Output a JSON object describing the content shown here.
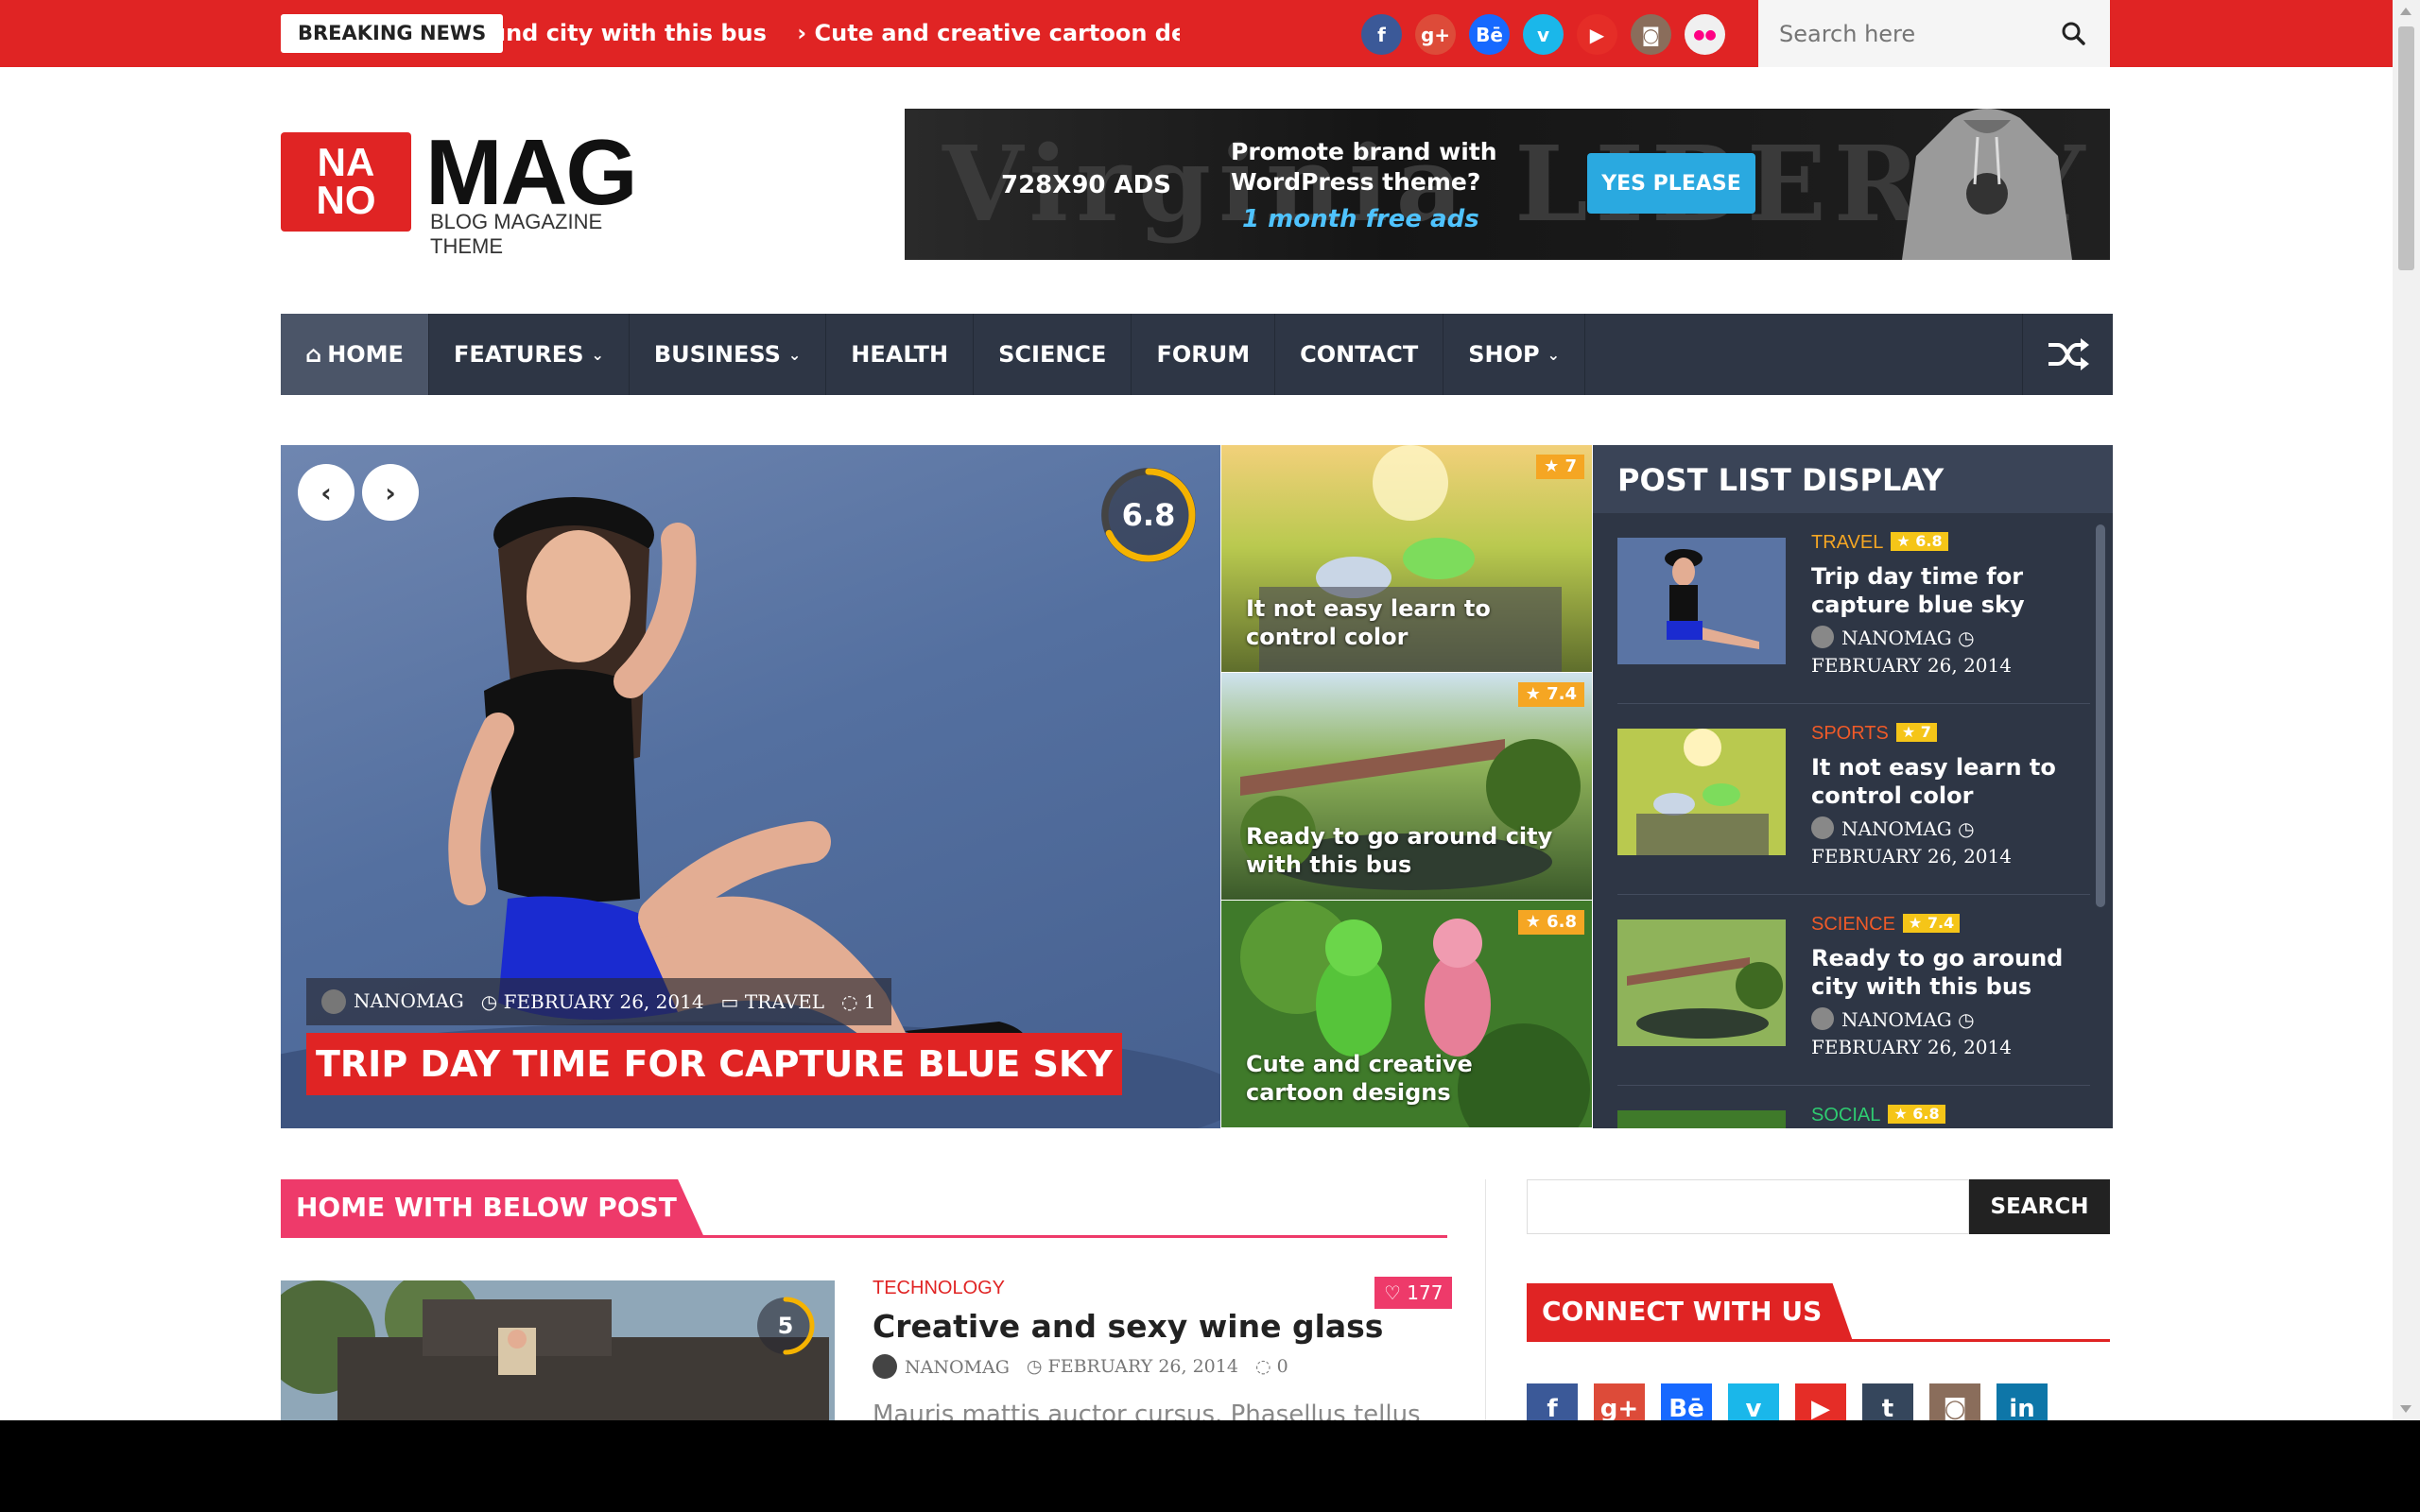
{
  "topbar": {
    "breaking_label": "BREAKING NEWS",
    "ticker": [
      "und city with this bus",
      "› Cute and creative cartoon designs",
      "›"
    ],
    "social": [
      {
        "icon": "facebook-icon",
        "glyph": "f",
        "color": "#3b5998"
      },
      {
        "icon": "google-plus-icon",
        "glyph": "g+",
        "color": "#dd4b39"
      },
      {
        "icon": "behance-icon",
        "glyph": "Bē",
        "color": "#1769ff"
      },
      {
        "icon": "vimeo-icon",
        "glyph": "v",
        "color": "#1ab7ea"
      },
      {
        "icon": "youtube-icon",
        "glyph": "▶",
        "color": "#e52d27"
      },
      {
        "icon": "instagram-icon",
        "glyph": "◙",
        "color": "#8a6d5b"
      },
      {
        "icon": "flickr-icon",
        "glyph": "●●",
        "color": "#f0f0f0"
      }
    ],
    "search_placeholder": "Search here"
  },
  "logo": {
    "box_line1": "NA",
    "box_line2": "NO",
    "word": "MAG",
    "tagline": "BLOG MAGAZINE THEME"
  },
  "ad": {
    "bg_text": "Virginia LIBERTY OR",
    "size_label": "728X90 ADS",
    "promo_line1": "Promote brand with",
    "promo_line2": "WordPress theme?",
    "free": "1 month free ads",
    "button": "YES PLEASE"
  },
  "nav": {
    "items": [
      {
        "label": "HOME",
        "icon": "home-icon",
        "active": true,
        "dropdown": false
      },
      {
        "label": "FEATURES",
        "dropdown": true
      },
      {
        "label": "BUSINESS",
        "dropdown": true
      },
      {
        "label": "HEALTH",
        "dropdown": false
      },
      {
        "label": "SCIENCE",
        "dropdown": false
      },
      {
        "label": "FORUM",
        "dropdown": false
      },
      {
        "label": "CONTACT",
        "dropdown": false
      },
      {
        "label": "SHOP",
        "dropdown": true
      }
    ]
  },
  "hero": {
    "score": "6.8",
    "score_fraction": 0.68,
    "author": "NANOMAG",
    "date": "FEBRUARY 26, 2014",
    "category": "TRAVEL",
    "comments": "1",
    "title": "TRIP DAY TIME FOR CAPTURE BLUE SKY"
  },
  "tiles": [
    {
      "rating": "★ 7",
      "title": "It not easy learn to control color"
    },
    {
      "rating": "★ 7.4",
      "title": "Ready to go around city with this bus"
    },
    {
      "rating": "★ 6.8",
      "title": "Cute and creative cartoon designs"
    }
  ],
  "post_list": {
    "heading": "POST LIST DISPLAY",
    "items": [
      {
        "category": "TRAVEL",
        "cat_color": "#f5a623",
        "rating": "★ 6.8",
        "title": "Trip day time for capture blue sky",
        "author": "NANOMAG",
        "date": "FEBRUARY 26, 2014"
      },
      {
        "category": "SPORTS",
        "cat_color": "#f05a28",
        "rating": "★ 7",
        "title": "It not easy learn to control color",
        "author": "NANOMAG",
        "date": "FEBRUARY 26, 2014"
      },
      {
        "category": "SCIENCE",
        "cat_color": "#f05a28",
        "rating": "★ 7.4",
        "title": "Ready to go around city with this bus",
        "author": "NANOMAG",
        "date": "FEBRUARY 26, 2014"
      },
      {
        "category": "SOCIAL",
        "cat_color": "#2ecc71",
        "rating": "★ 6.8",
        "title": "",
        "author": "",
        "date": ""
      }
    ]
  },
  "below": {
    "section_title": "HOME WITH BELOW POST",
    "post": {
      "score": "5",
      "category": "TECHNOLOGY",
      "likes": "♡ 177",
      "title": "Creative and sexy wine glass",
      "author": "NANOMAG",
      "date": "FEBRUARY 26, 2014",
      "comments": "0",
      "excerpt": "Mauris mattis auctor cursus. Phasellus tellus"
    }
  },
  "sidebar": {
    "search_button": "SEARCH",
    "connect_title": "CONNECT WITH US",
    "connect_icons": [
      {
        "icon": "facebook-icon",
        "glyph": "f",
        "color": "#3b5998"
      },
      {
        "icon": "google-plus-icon",
        "glyph": "g+",
        "color": "#dd4b39"
      },
      {
        "icon": "behance-icon",
        "glyph": "Bē",
        "color": "#1769ff"
      },
      {
        "icon": "vimeo-icon",
        "glyph": "v",
        "color": "#1ab7ea"
      },
      {
        "icon": "youtube-icon",
        "glyph": "▶",
        "color": "#e52d27"
      },
      {
        "icon": "tumblr-icon",
        "glyph": "t",
        "color": "#35465c"
      },
      {
        "icon": "instagram-icon",
        "glyph": "◙",
        "color": "#8a6d5b"
      },
      {
        "icon": "linkedin-icon",
        "glyph": "in",
        "color": "#0e76a8"
      }
    ]
  }
}
